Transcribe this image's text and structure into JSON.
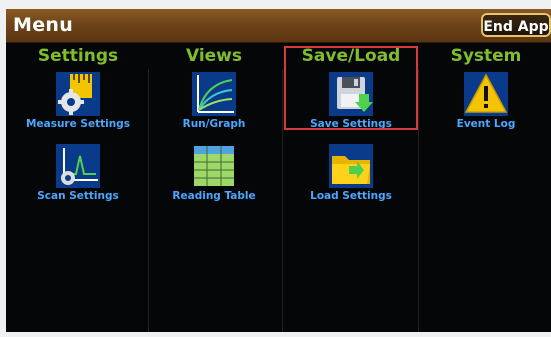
{
  "header": {
    "title": "Menu",
    "end_app_label": "End App"
  },
  "columns": [
    {
      "heading": "Settings",
      "items": [
        {
          "label": "Measure Settings",
          "icon": "measure-settings-icon"
        },
        {
          "label": "Scan Settings",
          "icon": "scan-settings-icon"
        }
      ]
    },
    {
      "heading": "Views",
      "items": [
        {
          "label": "Run/Graph",
          "icon": "graph-icon"
        },
        {
          "label": "Reading Table",
          "icon": "table-icon"
        }
      ]
    },
    {
      "heading": "Save/Load",
      "items": [
        {
          "label": "Save Settings",
          "icon": "save-icon"
        },
        {
          "label": "Load Settings",
          "icon": "load-folder-icon"
        }
      ]
    },
    {
      "heading": "System",
      "items": [
        {
          "label": "Event Log",
          "icon": "warning-icon"
        }
      ]
    }
  ],
  "colors": {
    "heading": "#7fbf2e",
    "label": "#4aa8ff",
    "highlight": "#d83a3a",
    "titlebar": "#6f4418"
  }
}
